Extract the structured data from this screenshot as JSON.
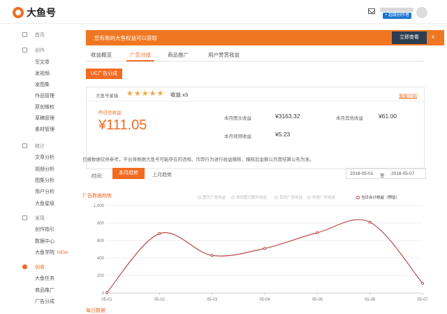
{
  "header": {
    "logo_text": "大鱼号",
    "creator_badge": "+ 超级创作者"
  },
  "sidebar": {
    "items": [
      {
        "label": "首页",
        "group": true,
        "icon": "home-icon"
      },
      {
        "label": "创作",
        "group": true,
        "icon": "pen-icon"
      },
      {
        "label": "写文章"
      },
      {
        "label": "发视频"
      },
      {
        "label": "发图集"
      },
      {
        "label": "作品管理"
      },
      {
        "label": "原创维权"
      },
      {
        "label": "草稿管理"
      },
      {
        "label": "素材管理"
      },
      {
        "label": "统计",
        "group": true,
        "icon": "chart-icon"
      },
      {
        "label": "文章分析"
      },
      {
        "label": "视频分析"
      },
      {
        "label": "图集分析"
      },
      {
        "label": "用户分析"
      },
      {
        "label": "大鱼星级"
      },
      {
        "label": "发现",
        "group": true,
        "icon": "eye-icon"
      },
      {
        "label": "创作指引"
      },
      {
        "label": "数据中心"
      },
      {
        "label": "大鱼学院",
        "tag": "NEW"
      },
      {
        "label": "创收",
        "group": true,
        "icon": "money-icon",
        "active": true
      },
      {
        "label": "大鱼任务"
      },
      {
        "label": "商品推广"
      },
      {
        "label": "广告分成"
      }
    ]
  },
  "banner": {
    "text": "您有新的大鱼权益可以获取",
    "button": "立即查看",
    "close": "x"
  },
  "tabs": [
    "收益概览",
    "广告分成",
    "商品推广",
    "用户赞赏收益"
  ],
  "uc_button": "UC广告分成",
  "card": {
    "level_label": "大鱼号星级",
    "stars": "★★★★★",
    "income_mult": "收益 x3",
    "level_link": "星级介绍",
    "yesterday_label": "昨日总收益",
    "yesterday_value": "¥111.05",
    "stats": [
      {
        "label": "本月图文收益",
        "value": "¥3163.32"
      },
      {
        "label": "本月其他收益",
        "value": "¥61.00"
      },
      {
        "label": "本月视频收益",
        "value": "¥5.23"
      }
    ]
  },
  "disclaimer": "日报数据仅供参考，平台将根据大鱼号可能存在的违规、作弊行为进行收益稽核，稽核后金额以月度结算公布为准。",
  "time_filter": {
    "label": "时间:",
    "this_month": "本月趋势",
    "last_month": "上月趋势",
    "date_from": "2018-05-01",
    "date_sep": "至",
    "date_to": "2018-05-07"
  },
  "chart_section_title": "广告数据趋势",
  "bottom_section_title": "每日数据",
  "chart_data": {
    "type": "line",
    "x": [
      "05-01",
      "05-02",
      "05-03",
      "05-04",
      "05-05",
      "05-06",
      "05-07"
    ],
    "legend": [
      "图文广告收益",
      "原创图文额外收益",
      "其他广告收益",
      "视频广告收益",
      "当日合计收益（预估）"
    ],
    "series": [
      {
        "name": "当日合计收益（预估）",
        "color": "#b94a48",
        "values": [
          5,
          680,
          430,
          510,
          690,
          810,
          111
        ]
      }
    ],
    "ylim": [
      0,
      1000
    ],
    "yticks": [
      0,
      200,
      400,
      600,
      800,
      "1,000"
    ],
    "grid": true
  }
}
